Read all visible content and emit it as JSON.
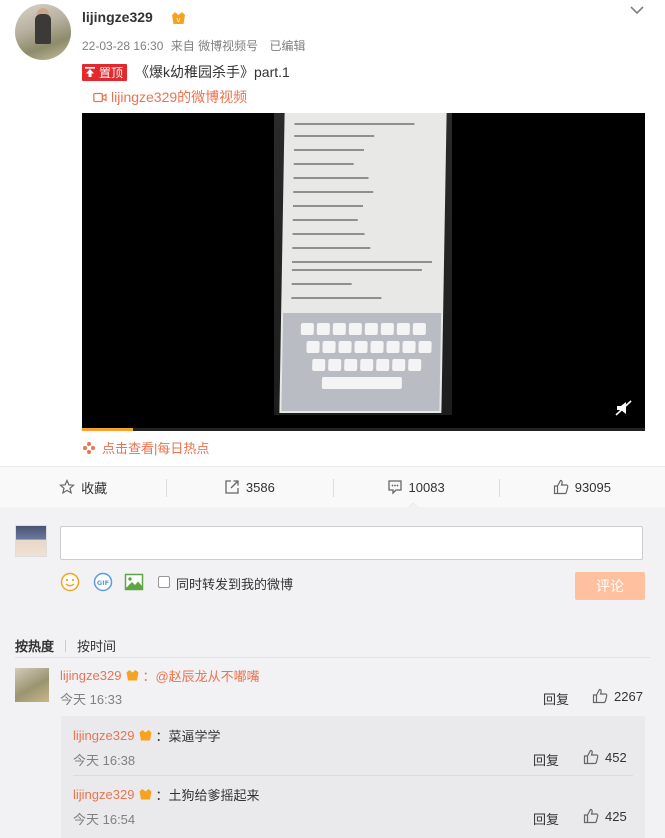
{
  "post": {
    "username": "lijingze329",
    "date": "22-03-28 16:30",
    "source": "来自 微博视频号",
    "edited": "已编辑",
    "pin_label": "置顶",
    "title": "《爆k幼稚园杀手》part.1",
    "video_link": "lijingze329的微博视频",
    "hot_text": "点击查看|每日热点",
    "video_progress": 0.09
  },
  "actions": {
    "favorite": "收藏",
    "repost": "3586",
    "comment": "10083",
    "like": "93095"
  },
  "composer": {
    "input_value": "",
    "forward_label": "同时转发到我的微博",
    "submit_label": "评论"
  },
  "sort": {
    "by_hot": "按热度",
    "by_time": "按时间"
  },
  "comments": [
    {
      "name": "lijingze329",
      "text": "：@赵辰龙从不嘟嘴",
      "time": "今天 16:33",
      "reply": "回复",
      "likes": "2267",
      "replies": [
        {
          "name": "lijingze329",
          "text": "：菜逼学学",
          "time": "今天 16:38",
          "reply": "回复",
          "likes": "452"
        },
        {
          "name": "lijingze329",
          "text": "：土狗给爹摇起来",
          "time": "今天 16:54",
          "reply": "回复",
          "likes": "425"
        }
      ]
    }
  ],
  "colors": {
    "accent": "#eb7350",
    "pin": "#e3292d",
    "submit": "#ffc09f",
    "progress": "#f8a22d"
  },
  "icons": [
    "vip-badge-icon",
    "chevron-down-icon",
    "pin-icon",
    "video-camera-icon",
    "volume-mute-icon",
    "hot-flower-icon",
    "star-icon",
    "repost-icon",
    "comment-icon",
    "thumb-up-icon",
    "emoji-icon",
    "gif-icon",
    "image-icon"
  ]
}
